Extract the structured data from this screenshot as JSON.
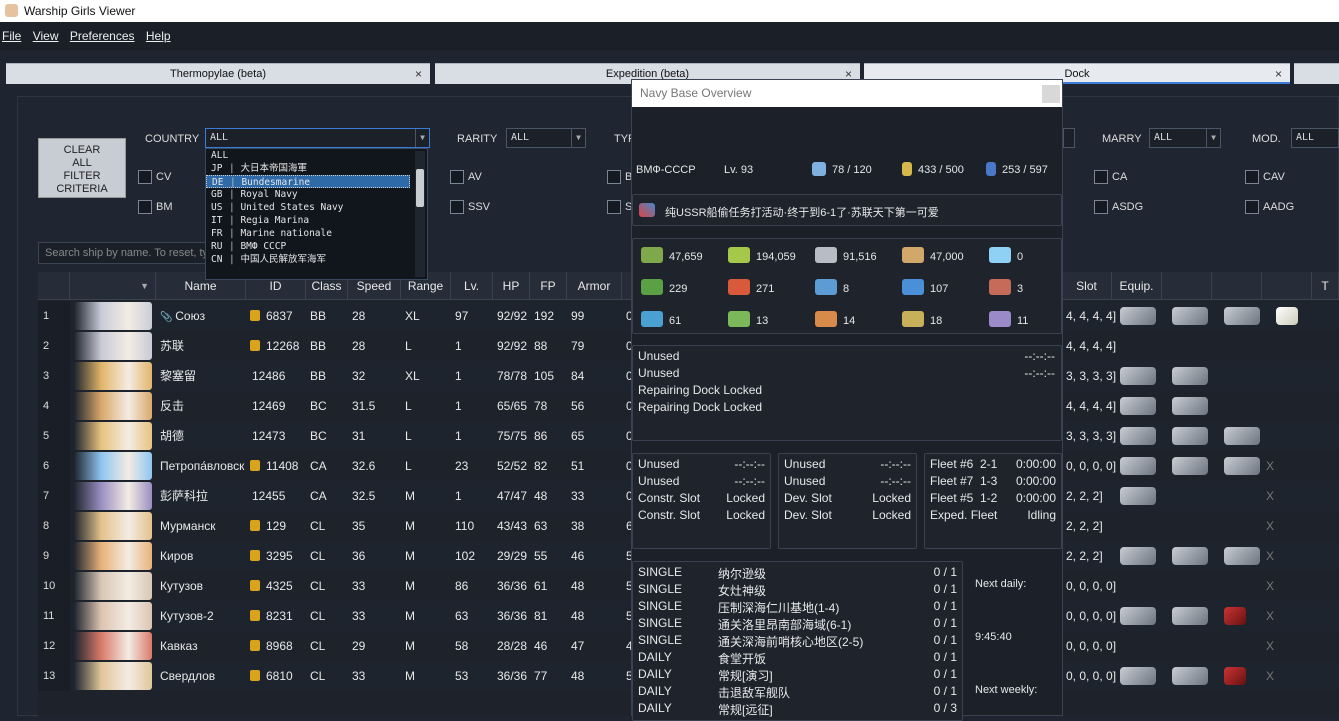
{
  "app": {
    "title": "Warship Girls Viewer"
  },
  "menu": [
    "File",
    "View",
    "Preferences",
    "Help"
  ],
  "tabs": [
    {
      "label": "Thermopylae (beta)",
      "close": "×"
    },
    {
      "label": "Expedition (beta)",
      "close": "×"
    },
    {
      "label": "Dock",
      "close": "×"
    }
  ],
  "filters": {
    "clear_label": [
      "CLEAR",
      "ALL",
      "FILTER",
      "CRITERIA"
    ],
    "country_label": "COUNTRY",
    "country_value": "ALL",
    "rarity_label": "RARITY",
    "rarity_value": "ALL",
    "type_label": "TYP",
    "marry_label": "MARRY",
    "marry_value": "ALL",
    "mod_label": "MOD.",
    "mod_value": "ALL",
    "extra_select_value": "",
    "checkboxes_left": [
      "CV",
      "BM"
    ],
    "checkboxes_mid": [
      "AV",
      "SSV"
    ],
    "checkboxes_b": [
      "B",
      "S"
    ],
    "checkboxes_right": [
      "CA",
      "ASDG",
      "CAV",
      "AADG"
    ],
    "search_placeholder": "Search ship by name. To reset, ty"
  },
  "country_options": [
    {
      "code": "ALL",
      "name": ""
    },
    {
      "code": "JP",
      "name": "大日本帝国海軍"
    },
    {
      "code": "DE",
      "name": "Bundesmarine",
      "selected": true
    },
    {
      "code": "GB",
      "name": "Royal Navy"
    },
    {
      "code": "US",
      "name": "United States Navy"
    },
    {
      "code": "IT",
      "name": "Regia Marina"
    },
    {
      "code": "FR",
      "name": "Marine nationale"
    },
    {
      "code": "RU",
      "name": "ВМФ СССР"
    },
    {
      "code": "CN",
      "name": "中国人民解放军海军"
    }
  ],
  "table": {
    "headers": [
      "Name",
      "ID",
      "Class",
      "Speed",
      "Range",
      "Lv.",
      "HP",
      "FP",
      "Armor",
      "Slot",
      "Equip.",
      "T"
    ],
    "rows": [
      {
        "n": "1",
        "name": "Союз",
        "id": "6837",
        "cls": "BB",
        "spd": "28",
        "rng": "XL",
        "lv": "97",
        "hp": "92/92",
        "fp": "192",
        "ar": "99",
        "rest": "0",
        "slot": "4, 4, 4, 4]",
        "lock": true,
        "clip": true,
        "col": "#c9ccd8",
        "eq": 4,
        "x": false
      },
      {
        "n": "2",
        "name": "苏联",
        "id": "12268",
        "cls": "BB",
        "spd": "28",
        "rng": "L",
        "lv": "1",
        "hp": "92/92",
        "fp": "88",
        "ar": "79",
        "rest": "0",
        "slot": "4, 4, 4, 4]",
        "lock": true,
        "col": "#c8cad6",
        "eq": 0,
        "x": false
      },
      {
        "n": "3",
        "name": "黎塞留",
        "id": "12486",
        "cls": "BB",
        "spd": "32",
        "rng": "XL",
        "lv": "1",
        "hp": "78/78",
        "fp": "105",
        "ar": "84",
        "rest": "0",
        "slot": "3, 3, 3, 3]",
        "col": "#e2b56a",
        "eq": 2,
        "x": false
      },
      {
        "n": "4",
        "name": "反击",
        "id": "12469",
        "cls": "BC",
        "spd": "31.5",
        "rng": "L",
        "lv": "1",
        "hp": "65/65",
        "fp": "78",
        "ar": "56",
        "rest": "0",
        "slot": "4, 4, 4, 4]",
        "col": "#d9a86b",
        "eq": 2,
        "x": false
      },
      {
        "n": "5",
        "name": "胡德",
        "id": "12473",
        "cls": "BC",
        "spd": "31",
        "rng": "L",
        "lv": "1",
        "hp": "75/75",
        "fp": "86",
        "ar": "65",
        "rest": "0",
        "slot": "3, 3, 3, 3]",
        "col": "#e7c37e",
        "eq": 3,
        "x": false
      },
      {
        "n": "6",
        "name": "Петропа́вловск",
        "id": "11408",
        "cls": "CA",
        "spd": "32.6",
        "rng": "L",
        "lv": "23",
        "hp": "52/52",
        "fp": "82",
        "ar": "51",
        "rest": "0",
        "slot": "0, 0, 0, 0]",
        "lock": true,
        "col": "#8fc5f0",
        "eq": 3,
        "x": true
      },
      {
        "n": "7",
        "name": "彭萨科拉",
        "id": "12455",
        "cls": "CA",
        "spd": "32.5",
        "rng": "M",
        "lv": "1",
        "hp": "47/47",
        "fp": "48",
        "ar": "33",
        "rest": "0",
        "slot": "2, 2, 2]",
        "col": "#9a8fc2",
        "eq": 1,
        "x": true
      },
      {
        "n": "8",
        "name": "Мурманск",
        "id": "129",
        "cls": "CL",
        "spd": "35",
        "rng": "M",
        "lv": "110",
        "hp": "43/43",
        "fp": "63",
        "ar": "38",
        "rest": "6",
        "slot": "2, 2, 2]",
        "lock": true,
        "col": "#e3c28b",
        "eq": 0,
        "x": true
      },
      {
        "n": "9",
        "name": "Киров",
        "id": "3295",
        "cls": "CL",
        "spd": "36",
        "rng": "M",
        "lv": "102",
        "hp": "29/29",
        "fp": "55",
        "ar": "46",
        "rest": "5",
        "slot": "2, 2, 2]",
        "lock": true,
        "col": "#e8b27a",
        "eq": 3,
        "x": true
      },
      {
        "n": "10",
        "name": "Кутузов",
        "id": "4325",
        "cls": "CL",
        "spd": "33",
        "rng": "M",
        "lv": "86",
        "hp": "36/36",
        "fp": "61",
        "ar": "48",
        "rest": "5",
        "slot": "0, 0, 0, 0]",
        "lock": true,
        "col": "#d8c7b5",
        "eq": 0,
        "x": true
      },
      {
        "n": "11",
        "name": "Кутузов-2",
        "id": "8231",
        "cls": "CL",
        "spd": "33",
        "rng": "M",
        "lv": "63",
        "hp": "36/36",
        "fp": "81",
        "ar": "48",
        "rest": "5",
        "slot": "0, 0, 0, 0]",
        "lock": true,
        "col": "#ddc4b1",
        "eq": 3,
        "x": true
      },
      {
        "n": "12",
        "name": "Кавказ",
        "id": "8968",
        "cls": "CL",
        "spd": "29",
        "rng": "M",
        "lv": "58",
        "hp": "28/28",
        "fp": "46",
        "ar": "47",
        "rest": "4",
        "slot": "0, 0, 0, 0]",
        "lock": true,
        "col": "#d97a6a",
        "eq": 0,
        "x": true
      },
      {
        "n": "13",
        "name": "Свердлов",
        "id": "6810",
        "cls": "CL",
        "spd": "33",
        "rng": "M",
        "lv": "53",
        "hp": "36/36",
        "fp": "77",
        "ar": "48",
        "rest": "5",
        "slot": "0, 0, 0, 0]",
        "lock": true,
        "col": "#e0c69a",
        "eq": 3,
        "x": true
      }
    ]
  },
  "overlay": {
    "title": "Navy Base Overview",
    "navy": "ВМФ-СССР",
    "level": "Lv. 93",
    "ships": "78 / 120",
    "equip": "433 / 500",
    "slots": "253 / 597",
    "motto": "纯USSR船偷任务打活动·终于到6-1了·苏联天下第一可爱",
    "resources": [
      {
        "v": "47,659",
        "c": "#7ea84a"
      },
      {
        "v": "194,059",
        "c": "#a5c84a"
      },
      {
        "v": "91,516",
        "c": "#b8bcc4"
      },
      {
        "v": "47,000",
        "c": "#d2a86a"
      },
      {
        "v": "0",
        "c": "#8fd0f5"
      },
      {
        "v": "229",
        "c": "#5aa044"
      },
      {
        "v": "271",
        "c": "#d85a3a"
      },
      {
        "v": "8",
        "c": "#5d9bd5"
      },
      {
        "v": "107",
        "c": "#4a90d8"
      },
      {
        "v": "3",
        "c": "#c46b5a"
      },
      {
        "v": "61",
        "c": "#4aa0d0"
      },
      {
        "v": "13",
        "c": "#7ab85a"
      },
      {
        "v": "14",
        "c": "#d88a4a"
      },
      {
        "v": "18",
        "c": "#c8b05a"
      },
      {
        "v": "11",
        "c": "#9a8ac8"
      }
    ],
    "repair": [
      {
        "label": "Unused",
        "time": "--:--:--"
      },
      {
        "label": "Unused",
        "time": "--:--:--"
      },
      {
        "label": "Repairing Dock Locked",
        "time": ""
      },
      {
        "label": "Repairing Dock Locked",
        "time": ""
      }
    ],
    "construct": [
      {
        "label": "Unused",
        "time": "--:--:--"
      },
      {
        "label": "Unused",
        "time": "--:--:--"
      },
      {
        "label": "Constr. Slot",
        "time": "Locked"
      },
      {
        "label": "Constr. Slot",
        "time": "Locked"
      }
    ],
    "develop": [
      {
        "label": "Unused",
        "time": "--:--:--"
      },
      {
        "label": "Unused",
        "time": "--:--:--"
      },
      {
        "label": "Dev. Slot",
        "time": "Locked"
      },
      {
        "label": "Dev. Slot",
        "time": "Locked"
      }
    ],
    "fleets": [
      {
        "label": "Fleet #6",
        "map": "2-1",
        "time": "0:00:00"
      },
      {
        "label": "Fleet #7",
        "map": "1-3",
        "time": "0:00:00"
      },
      {
        "label": "Fleet #5",
        "map": "1-2",
        "time": "0:00:00"
      },
      {
        "label": "Exped. Fleet",
        "map": "",
        "time": "Idling"
      }
    ],
    "tasks": [
      {
        "type": "SINGLE",
        "name": "纳尔逊级",
        "prog": "0 / 1"
      },
      {
        "type": "SINGLE",
        "name": "女灶神级",
        "prog": "0 / 1"
      },
      {
        "type": "SINGLE",
        "name": "压制深海仁川基地(1-4)",
        "prog": "0 / 1"
      },
      {
        "type": "SINGLE",
        "name": "通关洛里昂南部海域(6-1)",
        "prog": "0 / 1"
      },
      {
        "type": "SINGLE",
        "name": "通关深海前哨核心地区(2-5)",
        "prog": "0 / 1"
      },
      {
        "type": "DAILY",
        "name": "食堂开饭",
        "prog": "0 / 1"
      },
      {
        "type": "DAILY",
        "name": "常规[演习]",
        "prog": "0 / 1"
      },
      {
        "type": "DAILY",
        "name": "击退敌军舰队",
        "prog": "0 / 1"
      },
      {
        "type": "DAILY",
        "name": "常规[远征]",
        "prog": "0 / 3"
      }
    ],
    "next_daily_label": "Next daily:",
    "next_daily_time": "9:45:40",
    "next_weekly_label": "Next weekly:"
  }
}
